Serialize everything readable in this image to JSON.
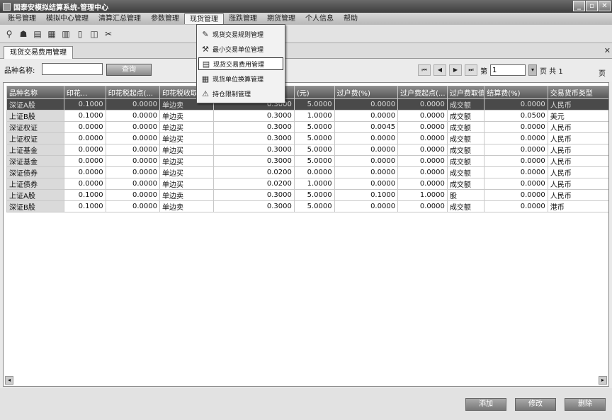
{
  "window": {
    "title": "国泰安模拟结算系统-管理中心",
    "min": "_",
    "restore": "▫",
    "close": "✕"
  },
  "menu": [
    "账号管理",
    "模拟中心管理",
    "清算汇总管理",
    "参数管理",
    "现货管理",
    "涨跌管理",
    "期货管理",
    "个人信息",
    "帮助"
  ],
  "active_menu": 4,
  "dropdown": [
    {
      "icon": "wrench-icon",
      "glyph": "✎",
      "label": "现货交易规则管理"
    },
    {
      "icon": "hammer-icon",
      "glyph": "⚒",
      "label": "最小交易单位管理"
    },
    {
      "icon": "fee-icon",
      "glyph": "▤",
      "label": "现货交易费用管理"
    },
    {
      "icon": "calc-icon",
      "glyph": "▦",
      "label": "现货单位换算管理"
    },
    {
      "icon": "warning-icon",
      "glyph": "⚠",
      "label": "持仓限制管理"
    }
  ],
  "tab": "现货交易费用管理",
  "search": {
    "label": "品种名称:",
    "value": "",
    "button": "查询"
  },
  "pager": {
    "first": "⏮",
    "prev": "◀",
    "next": "▶",
    "last": "⏭",
    "page_prefix": "第",
    "page_value": "1",
    "page_suffix": "页 共 1",
    "unit": "页"
  },
  "table": {
    "headers": [
      "品种名称",
      "印花...",
      "印花税起点(...",
      "印花税收取...",
      "(元)",
      "过户费(%)",
      "过户费起点(...",
      "过户费取值...",
      "结算费(%)",
      "交易货币类型"
    ],
    "rows": [
      [
        "深证A股",
        "0.1000",
        "0.0000",
        "单边卖",
        "0.3000",
        "5.0000",
        "0.0000",
        "0.0000",
        "成交额",
        "0.0000",
        "人民币"
      ],
      [
        "上证B股",
        "0.1000",
        "0.0000",
        "单边卖",
        "0.3000",
        "1.0000",
        "0.0000",
        "0.0000",
        "成交额",
        "0.0500",
        "美元"
      ],
      [
        "深证权证",
        "0.0000",
        "0.0000",
        "单边买",
        "0.3000",
        "5.0000",
        "0.0045",
        "0.0000",
        "成交额",
        "0.0000",
        "人民币"
      ],
      [
        "上证权证",
        "0.0000",
        "0.0000",
        "单边买",
        "0.3000",
        "5.0000",
        "0.0000",
        "0.0000",
        "成交额",
        "0.0000",
        "人民币"
      ],
      [
        "上证基金",
        "0.0000",
        "0.0000",
        "单边买",
        "0.3000",
        "5.0000",
        "0.0000",
        "0.0000",
        "成交额",
        "0.0000",
        "人民币"
      ],
      [
        "深证基金",
        "0.0000",
        "0.0000",
        "单边买",
        "0.3000",
        "5.0000",
        "0.0000",
        "0.0000",
        "成交额",
        "0.0000",
        "人民币"
      ],
      [
        "深证债券",
        "0.0000",
        "0.0000",
        "单边买",
        "0.0200",
        "0.0000",
        "0.0000",
        "0.0000",
        "成交额",
        "0.0000",
        "人民币"
      ],
      [
        "上证债券",
        "0.0000",
        "0.0000",
        "单边买",
        "0.0200",
        "1.0000",
        "0.0000",
        "0.0000",
        "成交额",
        "0.0000",
        "人民币"
      ],
      [
        "上证A股",
        "0.1000",
        "0.0000",
        "单边卖",
        "0.3000",
        "5.0000",
        "0.1000",
        "1.0000",
        "股",
        "0.0000",
        "人民币"
      ],
      [
        "深证B股",
        "0.1000",
        "0.0000",
        "单边卖",
        "0.3000",
        "5.0000",
        "0.0000",
        "0.0000",
        "成交额",
        "0.0000",
        "港币"
      ]
    ]
  },
  "footer": {
    "add": "添加",
    "edit": "修改",
    "delete": "删除"
  }
}
